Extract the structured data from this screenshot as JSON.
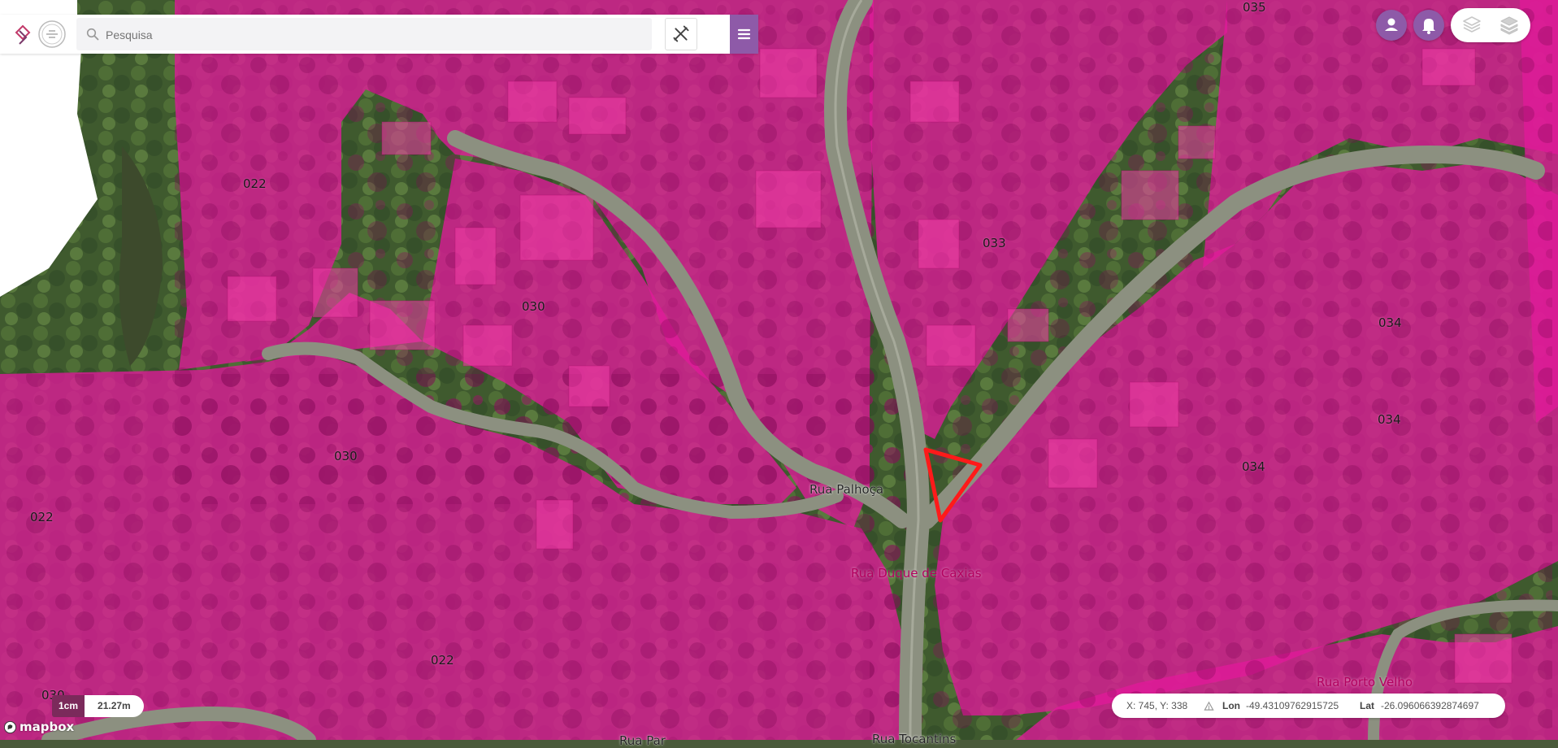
{
  "search": {
    "placeholder": "Pesquisa"
  },
  "parcel_labels": {
    "p022_a": "022",
    "p030_a": "030",
    "p033": "033",
    "p034_a": "034",
    "p034_b": "034",
    "p034_c": "034",
    "p035": "035",
    "p030_b": "030",
    "p022_b": "022",
    "p022_c": "022",
    "p030_c": "030"
  },
  "streets": {
    "palhoca": "Rua Palhoça",
    "duque_de_caxias": "Rua Duque de Caxias",
    "porto_velho": "Rua Porto Velho",
    "tocantins": "Rua Tocantins",
    "bottom_left": "Rua Par"
  },
  "scale": {
    "unit": "1cm",
    "value": "21.27m"
  },
  "coords": {
    "xy": "X: 745, Y: 338",
    "lon_label": "Lon",
    "lon_value": "-49.43109762915725",
    "lat_label": "Lat",
    "lat_value": "-26.096066392874697"
  },
  "attribution": {
    "text": "mapbox"
  },
  "icons": {
    "search": "search-icon",
    "tools": "pencil-ruler-icon",
    "menu": "hamburger-menu-icon",
    "user": "user-icon",
    "notifications": "bell-icon",
    "layers_off": "layers-outline-icon",
    "layers_on": "layers-icon",
    "altitude": "triangle-icon"
  },
  "colors": {
    "parcel_overlay": "#e0199a",
    "accent": "#8e5aa8",
    "selection": "#ff1a1a",
    "scale_unit_bg": "#7b2a5b"
  }
}
